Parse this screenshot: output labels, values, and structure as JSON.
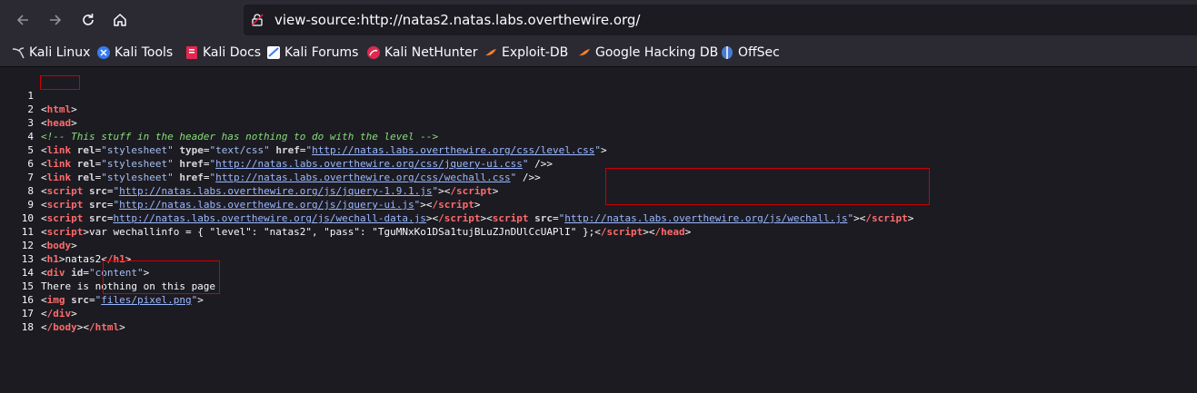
{
  "browser": {
    "url": "view-source:http://natas2.natas.labs.overthewire.org/"
  },
  "bookmarks": [
    {
      "label": "Kali Linux"
    },
    {
      "label": "Kali Tools"
    },
    {
      "label": "Kali Docs"
    },
    {
      "label": "Kali Forums"
    },
    {
      "label": "Kali NetHunter"
    },
    {
      "label": "Exploit-DB"
    },
    {
      "label": "Google Hacking DB"
    },
    {
      "label": "OffSec"
    }
  ],
  "source": {
    "line_numbers": [
      "1",
      "2",
      "3",
      "4",
      "5",
      "6",
      "7",
      "8",
      "9",
      "10",
      "11",
      "12",
      "13",
      "14",
      "15",
      "16",
      "17",
      "18"
    ],
    "l1": {
      "tag": "html"
    },
    "l2": {
      "tag": "head"
    },
    "l3": {
      "comment": "<!-- This stuff in the header has nothing to do with the level -->"
    },
    "l4": {
      "tag": "link",
      "attr1": "rel",
      "val1": "\"stylesheet\"",
      "attr2": "type",
      "val2": "\"text/css\"",
      "attr3": "href",
      "href": "http://natas.labs.overthewire.org/css/level.css"
    },
    "l5": {
      "tag": "link",
      "attr1": "rel",
      "val1": "\"stylesheet\"",
      "attr2": "href",
      "href": "http://natas.labs.overthewire.org/css/jquery-ui.css",
      "end": " />"
    },
    "l6": {
      "tag": "link",
      "attr1": "rel",
      "val1": "\"stylesheet\"",
      "attr2": "href",
      "href": "http://natas.labs.overthewire.org/css/wechall.css",
      "end": " />"
    },
    "l7": {
      "tag": "script",
      "attr": "src",
      "href": "http://natas.labs.overthewire.org/js/jquery-1.9.1.js",
      "close": "/script"
    },
    "l8": {
      "tag": "script",
      "attr": "src",
      "href": "http://natas.labs.overthewire.org/js/jquery-ui.js",
      "close": "/script"
    },
    "l9": {
      "tag": "script",
      "attr": "src",
      "href1": "http://natas.labs.overthewire.org/js/wechall-data.js",
      "close": "/script",
      "tag2": "script",
      "attr2": "src",
      "href2": "http://natas.labs.overthewire.org/js/wechall.js"
    },
    "l10": {
      "tag": "script",
      "text": "var wechallinfo = { \"level\": \"natas2\", \"pass\": \"TguMNxKo1DSa1tujBLuZJnDUlCcUAPlI\" };",
      "close1": "/script",
      "close2": "/head"
    },
    "l11": {
      "tag": "body"
    },
    "l12": {
      "tag": "h1",
      "text": "natas2",
      "close": "/h1"
    },
    "l13": {
      "tag": "div",
      "attr": "id",
      "val": "\"content\""
    },
    "l14": {
      "text": "There is nothing on this page"
    },
    "l15": {
      "tag": "img",
      "attr": "src",
      "href": "files/pixel.png"
    },
    "l16": {
      "close": "/div"
    },
    "l17": {
      "close1": "/body",
      "close2": "/html"
    }
  }
}
